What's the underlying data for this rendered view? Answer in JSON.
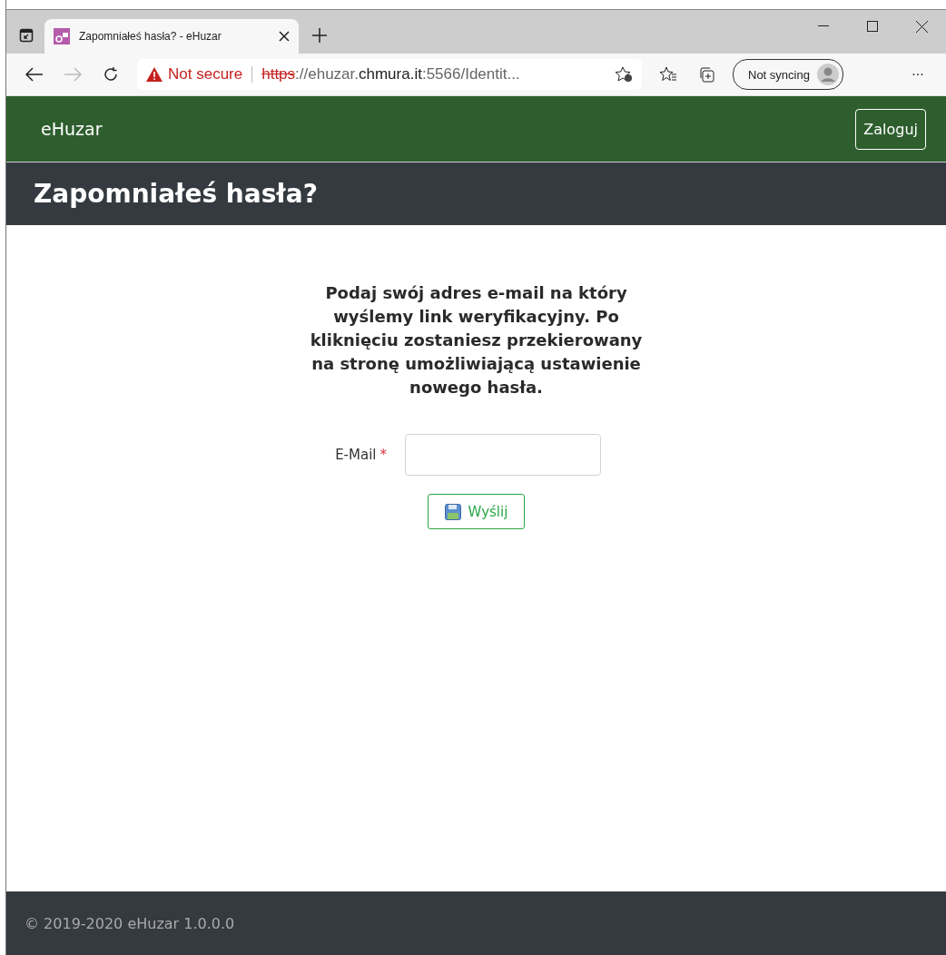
{
  "browser": {
    "tab_title": "Zapomniałeś hasła? - eHuzar",
    "security": "Not secure",
    "url": {
      "scheme": "https",
      "host_prefix": "://ehuzar.",
      "host": "chmura.it",
      "rest": ":5566/Identit..."
    },
    "sync": "Not syncing",
    "more": "···"
  },
  "navbar": {
    "brand": "eHuzar",
    "login": "Zaloguj"
  },
  "page_title": "Zapomniałeś hasła?",
  "intro": "Podaj swój adres e-mail na który wyślemy link weryfikacyjny. Po kliknięciu zostaniesz przekierowany na stronę umożliwiającą ustawienie nowego hasła.",
  "form": {
    "label": "E-Mail",
    "required": true,
    "required_mark": "*",
    "submit": "Wyślij"
  },
  "footer": "© 2019-2020 eHuzar 1.0.0.0"
}
